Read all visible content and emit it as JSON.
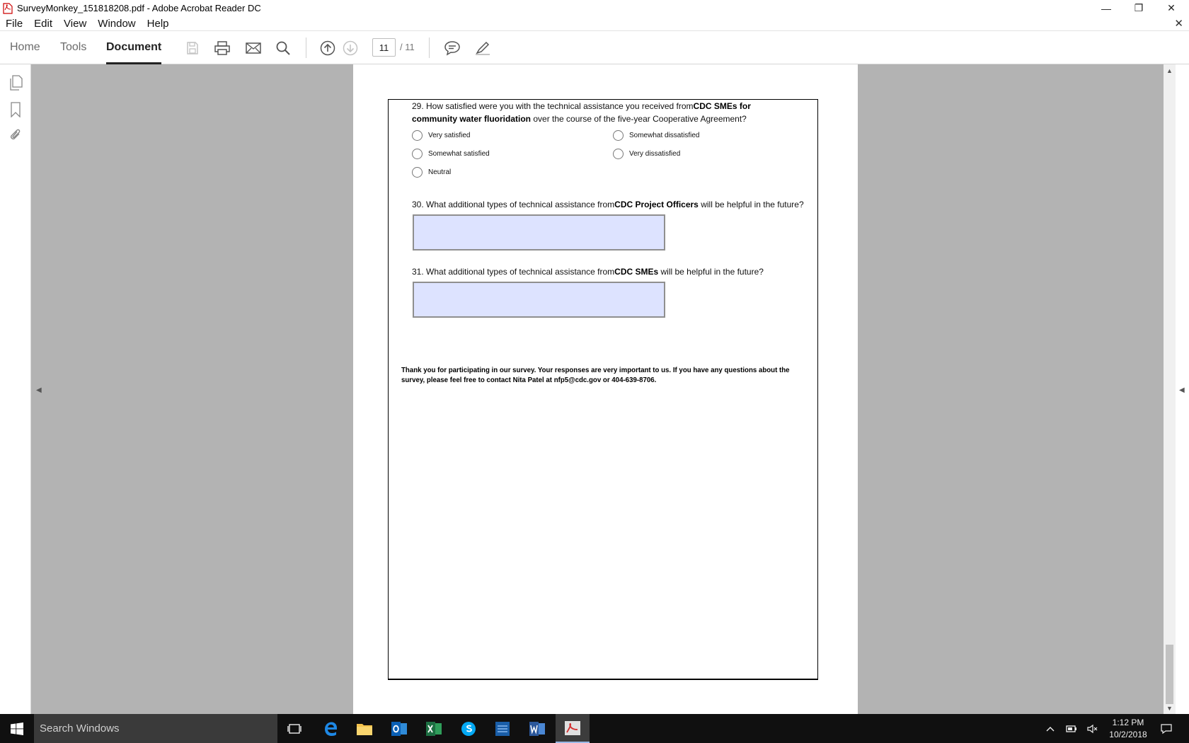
{
  "window": {
    "title": "SurveyMonkey_151818208.pdf - Adobe Acrobat Reader DC",
    "minimize": "—",
    "restore": "❐",
    "close": "✕"
  },
  "menubar": {
    "items": [
      "File",
      "Edit",
      "View",
      "Window",
      "Help"
    ],
    "close_doc": "✕"
  },
  "toolbar": {
    "tabs": [
      "Home",
      "Tools",
      "Document"
    ],
    "active_tab": "Document",
    "current_page": "11",
    "total_pages": "/ 11"
  },
  "document": {
    "q29": {
      "prefix": "29. How satisfied were you with the technical assistance you received from",
      "bold": "CDC SMEs for community water fluoridation",
      "suffix": " over the course of the five-year Cooperative Agreement?",
      "options": [
        "Very satisfied",
        "Somewhat satisfied",
        "Neutral",
        "Somewhat dissatisfied",
        "Very dissatisfied"
      ]
    },
    "q30": {
      "prefix": "30. What additional types of technical assistance from",
      "bold": "CDC Project Officers",
      "suffix": " will be helpful in the future?",
      "value": ""
    },
    "q31": {
      "prefix": "31. What additional types of technical assistance from",
      "bold": "CDC SMEs",
      "suffix": " will be helpful in the future?",
      "value": ""
    },
    "thanks": "Thank you for participating in our survey. Your responses are very important to us. If you have any questions about the survey, please feel free to contact Nita Patel at nfp5@cdc.gov or 404-639-8706."
  },
  "taskbar": {
    "search_placeholder": "Search Windows",
    "time": "1:12 PM",
    "date": "10/2/2018"
  },
  "colors": {
    "form_field_bg": "#dde3ff",
    "doc_background": "#b3b3b3",
    "taskbar_bg": "#101010"
  },
  "icons": [
    "pdf-icon",
    "save-icon",
    "print-icon",
    "email-icon",
    "search-icon",
    "prev-page-icon",
    "next-page-icon",
    "comment-icon",
    "highlight-icon",
    "page-thumbnails-icon",
    "bookmarks-icon",
    "attachments-icon",
    "windows-start-icon",
    "task-view-icon",
    "edge-icon",
    "file-explorer-icon",
    "outlook-icon",
    "excel-icon",
    "skype-icon",
    "sas-icon",
    "word-icon",
    "acrobat-icon",
    "show-hidden-icons-icon",
    "network-icon",
    "volume-icon",
    "notifications-icon"
  ]
}
